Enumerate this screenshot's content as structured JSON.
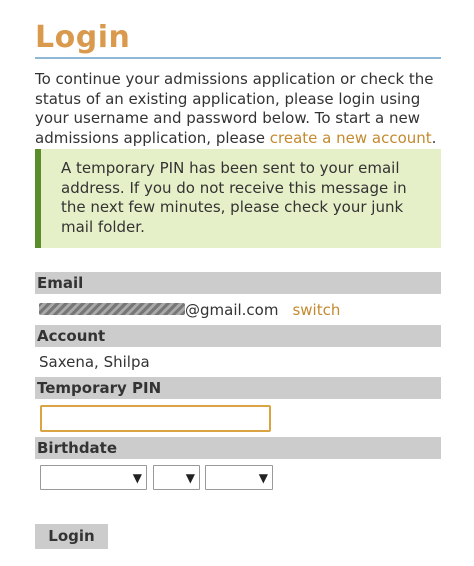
{
  "page": {
    "title": "Login",
    "intro_text": "To continue your admissions application or check the status of an existing application, please login using your username and password below. To start a new admissions application, please ",
    "intro_link": "create a new account",
    "intro_end": "."
  },
  "notice": {
    "text": "A temporary PIN has been sent to your email address. If you do not receive this message in the next few minutes, please check your junk mail folder."
  },
  "form": {
    "email": {
      "label": "Email",
      "domain": "@gmail.com",
      "switch_label": "switch"
    },
    "account": {
      "label": "Account",
      "value": "Saxena, Shilpa"
    },
    "pin": {
      "label": "Temporary PIN",
      "value": ""
    },
    "birthdate": {
      "label": "Birthdate",
      "month": "",
      "day": "",
      "year": ""
    },
    "submit_label": "Login"
  },
  "colors": {
    "title": "#d99a4e",
    "link": "#c48a2e",
    "notice_bg": "#e6f0c8",
    "notice_border": "#5b8c2a",
    "label_bar": "#cccccc",
    "input_focus": "#d9a441"
  },
  "icons": {
    "select_arrow": "caret-down-icon"
  }
}
